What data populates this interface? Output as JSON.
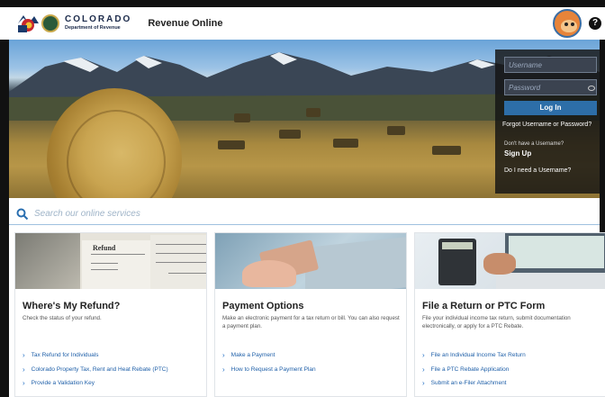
{
  "header": {
    "logo_title": "COLORADO",
    "logo_subtitle": "Department of Revenue",
    "app_title": "Revenue Online",
    "help_label": "?"
  },
  "login": {
    "username_placeholder": "Username",
    "password_placeholder": "Password",
    "login_button": "Log In",
    "forgot_link": "Forgot Username or Password?",
    "no_account_text": "Don't have a Username?",
    "signup_link": "Sign Up",
    "need_username_link": "Do I need a Username?"
  },
  "search": {
    "placeholder": "Search our online services"
  },
  "cards": [
    {
      "title": "Where's My Refund?",
      "description": "Check the status of your refund.",
      "image_text": "Refund",
      "links": [
        "Tax Refund for Individuals",
        "Colorado Property Tax, Rent and Heat Rebate (PTC)",
        "Provide a Validation Key"
      ]
    },
    {
      "title": "Payment Options",
      "description": "Make an electronic payment for a tax return or bill. You can also request a payment plan.",
      "links": [
        "Make a Payment",
        "How to Request a Payment Plan"
      ]
    },
    {
      "title": "File a Return or PTC Form",
      "description": "File your individual income tax return, submit documentation electronically, or apply for a PTC Rebate.",
      "links": [
        "File an Individual Income Tax Return",
        "File a PTC Rebate Application",
        "Submit an e-Filer Attachment"
      ]
    }
  ],
  "colors": {
    "accent": "#2d6ea8",
    "link": "#1e5fa8",
    "brand_navy": "#1b2a4a"
  }
}
